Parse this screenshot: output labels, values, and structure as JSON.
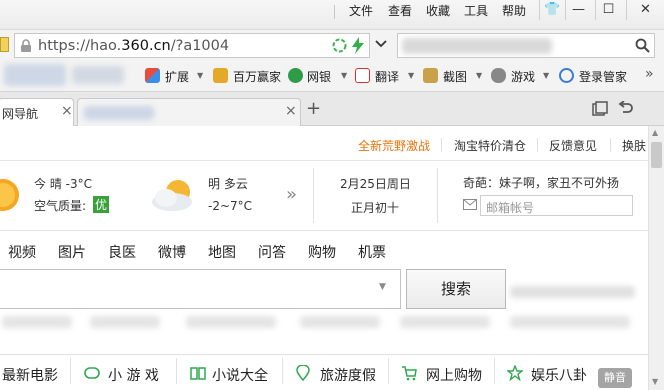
{
  "menubar": {
    "items": [
      "文件",
      "查看",
      "收藏",
      "工具",
      "帮助"
    ]
  },
  "window_controls": {
    "shirt": "👕",
    "minimize": "—",
    "maximize": "☐",
    "close": "✕"
  },
  "address": {
    "prefix": "https://hao.",
    "domain": "360.cn",
    "suffix": "/?a1004"
  },
  "search": {
    "icon": "search-icon"
  },
  "toolbar": {
    "items": [
      "扩展",
      "百万赢家",
      "网银",
      "翻译",
      "截图",
      "游戏",
      "登录管家"
    ]
  },
  "tabs": {
    "active_label": "网导航",
    "close_symbol": "×",
    "new_tab_symbol": "+"
  },
  "top_links": {
    "game": "全新荒野激战",
    "taobao": "淘宝特价清仓",
    "feedback": "反馈意见",
    "switch": "换肤"
  },
  "weather": {
    "today_label": "今 晴 -3°C",
    "air_quality_label": "空气质量:",
    "air_quality_value": "优",
    "tomorrow_label": "明 多云",
    "tomorrow_temp": "-2~7°C",
    "more_symbol": "»"
  },
  "date": {
    "gregorian": "2月25日周日",
    "lunar": "正月初十"
  },
  "quote": {
    "text": "奇葩：妹子啊，家丑不可外扬"
  },
  "mail": {
    "placeholder": "邮箱帐号"
  },
  "search_tabs": [
    "视频",
    "图片",
    "良医",
    "微博",
    "地图",
    "问答",
    "购物",
    "机票"
  ],
  "search_button": "搜索",
  "bottom_nav": [
    "最新电影",
    "小 游 戏",
    "小说大全",
    "旅游度假",
    "网上购物",
    "娱乐八卦"
  ],
  "mute_label": "静音",
  "colors": {
    "accent_orange": "#e8740c",
    "air_good_green": "#3aa03a",
    "link_blue": "#2a6bc4",
    "sun": "#f5a623"
  }
}
